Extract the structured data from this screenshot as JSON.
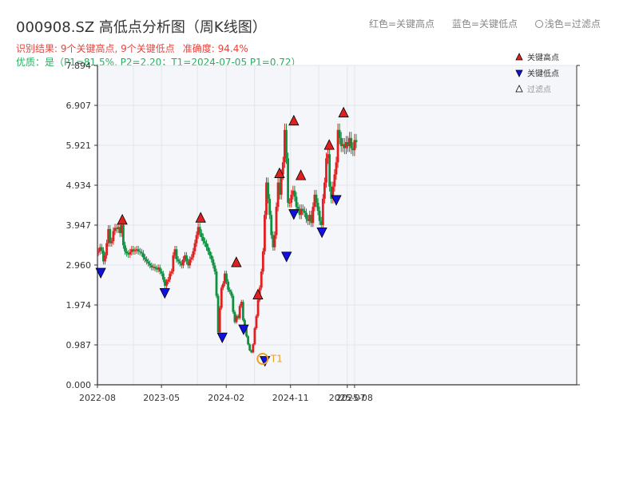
{
  "header": {
    "title": "000908.SZ 高低点分析图（周K线图）",
    "legend_high": "红色=关键高点",
    "legend_low": "蓝色=关键低点",
    "legend_filtered": "浅色=过滤点",
    "result_text": "识别结果: 9个关键高点, 9个关键低点",
    "accuracy_text": "准确度: 94.4%",
    "quality_text": "优质：是（P1=81.5%, P2=2.20；T1=2024-07-05 P1=0.72）"
  },
  "colors": {
    "up": "#e02020",
    "down": "#109040",
    "high_marker": "#e02020",
    "low_marker": "#1010e0",
    "t1_ring": "#f0a020",
    "plot_bg": "#f4f6f9",
    "grid": "#e2e6ec"
  },
  "chart_data": {
    "type": "candlestick",
    "title": "000908.SZ 高低点分析图（周K线图）",
    "yticks": [
      "0.000",
      "0.987",
      "1.974",
      "2.960",
      "3.947",
      "4.934",
      "5.921",
      "6.907",
      "7.894"
    ],
    "ylim": [
      0,
      7.894
    ],
    "xticks": [
      "2022-08",
      "2023-05",
      "2024-02",
      "2024-11",
      "2025-07",
      "2025-08"
    ],
    "legend": [
      {
        "name": "关键高点",
        "marker": "up-triangle",
        "color": "#e02020"
      },
      {
        "name": "关键低点",
        "marker": "down-triangle",
        "color": "#1010e0"
      },
      {
        "name": "过滤点",
        "marker": "up-triangle-outline",
        "color": "#999999"
      }
    ],
    "legend_placement": "top-right",
    "grid": true,
    "closes": [
      3.3,
      3.4,
      3.32,
      3.05,
      3.2,
      3.5,
      3.85,
      3.5,
      3.55,
      3.8,
      3.88,
      3.85,
      3.9,
      3.75,
      3.95,
      3.45,
      3.3,
      3.25,
      3.22,
      3.28,
      3.35,
      3.3,
      3.32,
      3.35,
      3.3,
      3.28,
      3.25,
      3.15,
      3.1,
      3.05,
      3.0,
      2.95,
      2.9,
      2.92,
      2.88,
      2.85,
      2.9,
      2.8,
      2.75,
      2.6,
      2.45,
      2.55,
      2.6,
      2.75,
      2.8,
      3.2,
      3.35,
      3.1,
      3.05,
      3.0,
      2.95,
      3.1,
      3.2,
      3.05,
      2.95,
      3.1,
      3.15,
      3.3,
      3.5,
      3.7,
      3.9,
      3.75,
      3.65,
      3.55,
      3.5,
      3.4,
      3.3,
      3.2,
      3.1,
      2.95,
      2.8,
      2.2,
      1.3,
      1.9,
      2.4,
      2.5,
      2.75,
      2.55,
      2.35,
      2.3,
      2.2,
      1.8,
      1.55,
      1.7,
      1.65,
      1.95,
      2.05,
      1.6,
      1.4,
      1.2,
      1.0,
      0.85,
      0.8,
      1.0,
      1.4,
      1.7,
      2.1,
      2.4,
      2.8,
      3.3,
      4.2,
      5.0,
      4.6,
      4.2,
      3.7,
      3.4,
      3.7,
      4.4,
      5.0,
      4.7,
      5.2,
      5.5,
      6.3,
      5.6,
      4.5,
      4.5,
      4.7,
      4.8,
      4.65,
      4.4,
      4.35,
      4.2,
      4.35,
      4.3,
      4.25,
      4.1,
      4.05,
      4.2,
      4.0,
      4.4,
      4.7,
      4.5,
      4.3,
      4.05,
      3.95,
      4.6,
      5.0,
      5.6,
      5.7,
      4.9,
      4.6,
      4.9,
      5.2,
      5.5,
      6.3,
      6.1,
      5.9,
      5.95,
      5.85,
      6.0,
      5.9,
      6.1,
      5.85,
      5.8,
      6.05,
      6.0
    ],
    "key_highs": [
      {
        "x": "2022-11",
        "value": 3.95
      },
      {
        "x": "2023-10",
        "value": 4.0
      },
      {
        "x": "2024-03",
        "value": 2.9
      },
      {
        "x": "2024-06",
        "value": 2.1
      },
      {
        "x": "2024-09",
        "value": 5.1
      },
      {
        "x": "2024-11",
        "value": 6.4
      },
      {
        "x": "2024-12",
        "value": 5.05
      },
      {
        "x": "2025-04",
        "value": 5.8
      },
      {
        "x": "2025-06",
        "value": 6.6
      }
    ],
    "key_lows": [
      {
        "x": "2022-08",
        "value": 2.9
      },
      {
        "x": "2023-05",
        "value": 2.4
      },
      {
        "x": "2024-01",
        "value": 1.3
      },
      {
        "x": "2024-04",
        "value": 1.5
      },
      {
        "x": "2024-07",
        "value": 0.72
      },
      {
        "x": "2024-10",
        "value": 3.3
      },
      {
        "x": "2024-11",
        "value": 4.35
      },
      {
        "x": "2025-03",
        "value": 3.9
      },
      {
        "x": "2025-05",
        "value": 4.7
      }
    ],
    "t1": {
      "label": "T1",
      "date": "2024-07-05",
      "value": 0.72
    }
  }
}
